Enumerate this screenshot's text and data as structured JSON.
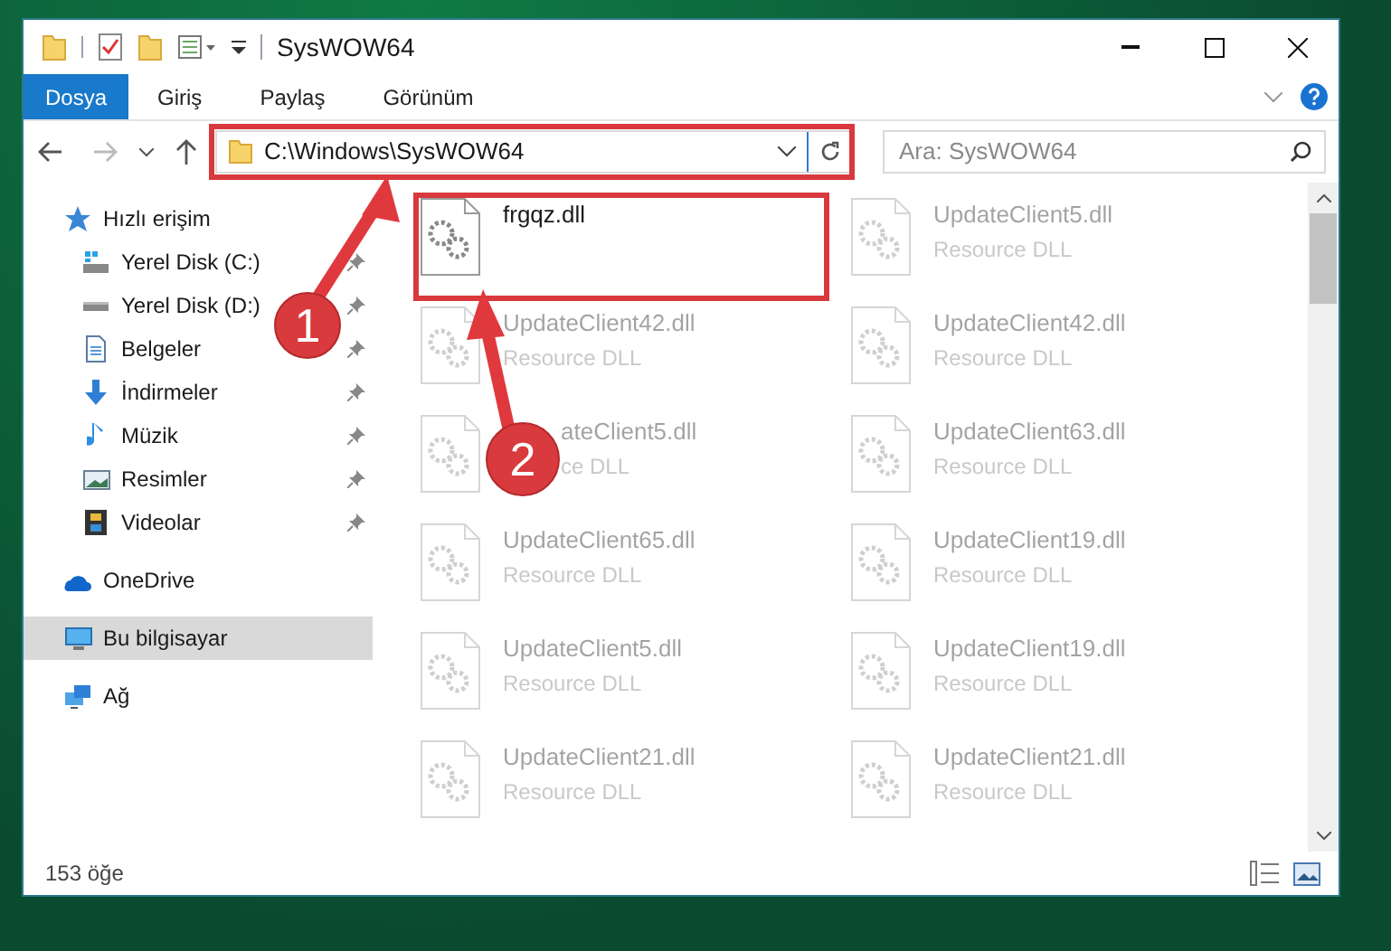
{
  "window": {
    "title": "SysWOW64"
  },
  "ribbon_tabs": [
    {
      "label": "Dosya",
      "selected": true
    },
    {
      "label": "Giriş",
      "selected": false
    },
    {
      "label": "Paylaş",
      "selected": false
    },
    {
      "label": "Görünüm",
      "selected": false
    }
  ],
  "address_bar": {
    "path": "C:\\Windows\\SysWOW64"
  },
  "search": {
    "placeholder": "Ara: SysWOW64"
  },
  "sidebar": {
    "items": [
      {
        "label": "Hızlı erişim",
        "kind": "star",
        "selected": false,
        "children": [
          {
            "label": "Yerel Disk (C:)",
            "kind": "disk-c",
            "pinned": true
          },
          {
            "label": "Yerel Disk (D:)",
            "kind": "disk",
            "pinned": true
          },
          {
            "label": "Belgeler",
            "kind": "doc",
            "pinned": true
          },
          {
            "label": "İndirmeler",
            "kind": "download",
            "pinned": true
          },
          {
            "label": "Müzik",
            "kind": "music",
            "pinned": true
          },
          {
            "label": "Resimler",
            "kind": "pictures",
            "pinned": true
          },
          {
            "label": "Videolar",
            "kind": "video",
            "pinned": true
          }
        ]
      },
      {
        "label": "OneDrive",
        "kind": "cloud",
        "selected": false
      },
      {
        "label": "Bu bilgisayar",
        "kind": "computer",
        "selected": true
      },
      {
        "label": "Ağ",
        "kind": "network",
        "selected": false
      }
    ]
  },
  "files": [
    {
      "name": "frgqz.dll",
      "kind": "plain",
      "faded": false
    },
    {
      "name": "UpdateClient5.dll",
      "type": "Resource DLL",
      "kind": "plain",
      "faded": true
    },
    {
      "name": "UpdateClient42.dll",
      "type": "Resource DLL",
      "kind": "plain",
      "faded": true
    },
    {
      "name": "UpdateClient42.dll",
      "type": "Resource DLL",
      "kind": "plain",
      "faded": true
    },
    {
      "name": "ateClient5.dll",
      "type": "ce DLL",
      "kind": "covered",
      "faded": true
    },
    {
      "name": "UpdateClient63.dll",
      "type": "Resource DLL",
      "kind": "plain",
      "faded": true
    },
    {
      "name": "UpdateClient65.dll",
      "type": "Resource DLL",
      "kind": "plain",
      "faded": true
    },
    {
      "name": "UpdateClient19.dll",
      "type": "Resource DLL",
      "kind": "plain",
      "faded": true
    },
    {
      "name": "UpdateClient5.dll",
      "type": "Resource DLL",
      "kind": "plain",
      "faded": true
    },
    {
      "name": "UpdateClient19.dll",
      "type": "Resource DLL",
      "kind": "plain",
      "faded": true
    },
    {
      "name": "UpdateClient21.dll",
      "type": "Resource DLL",
      "kind": "plain",
      "faded": true
    },
    {
      "name": "UpdateClient21.dll",
      "type": "Resource DLL",
      "kind": "plain",
      "faded": true
    }
  ],
  "status_bar": {
    "count": "153 öğe"
  },
  "annotations": [
    {
      "number": "1"
    },
    {
      "number": "2"
    }
  ]
}
